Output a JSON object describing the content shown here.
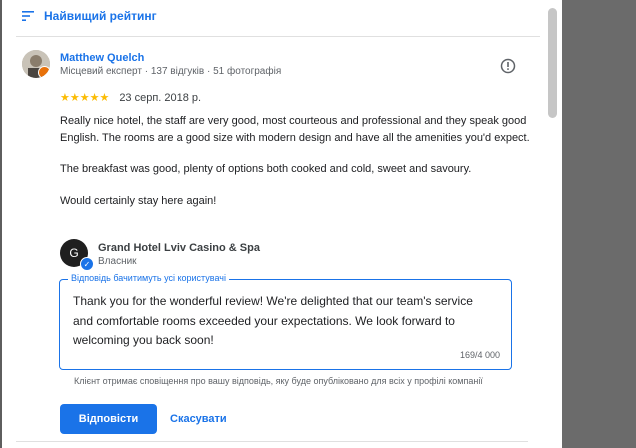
{
  "colors": {
    "accent": "#1a73e8",
    "star": "#fbbc04",
    "text": "#202124",
    "muted": "#5f6368"
  },
  "sort": {
    "icon": "sort-icon",
    "label": "Найвищий рейтинг"
  },
  "review": {
    "reviewer_name": "Matthew Quelch",
    "reviewer_meta": "Місцевий експерт · 137 відгуків · 51 фотографія",
    "rating": 5,
    "stars": "★★★★★",
    "date": "23 серп. 2018 р.",
    "paragraphs": [
      "Really nice hotel, the staff are very good, most courteous and professional and they speak good English. The rooms are a good size with modern design and have all the amenities you'd expect.",
      "The breakfast was good, plenty of options both cooked and cold, sweet and savoury.",
      "Would certainly stay here again!"
    ]
  },
  "owner": {
    "name": "Grand Hotel Lviv Casino & Spa",
    "role": "Власник",
    "avatar_glyph": "G"
  },
  "reply": {
    "legend": "Відповідь бачитимуть усі користувачі",
    "text": "Thank you for the wonderful review! We're delighted that our team's service and comfortable rooms exceeded your expectations. We look forward to welcoming you back soon!",
    "counter": "169/4 000",
    "notice": "Клієнт отримає сповіщення про вашу відповідь, яку буде опубліковано для всіх у профілі компанії"
  },
  "buttons": {
    "reply": "Відповісти",
    "cancel": "Скасувати"
  }
}
